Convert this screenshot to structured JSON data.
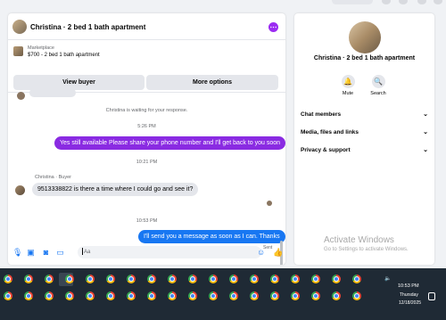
{
  "chat": {
    "header": {
      "title": "Christina · 2 bed 1 bath apartment",
      "more_icon": "more-dots-icon"
    },
    "marketplace": {
      "label": "Marketplace",
      "listing": "$700 - 2 bed 1 bath apartment",
      "view_buyer": "View buyer",
      "more_options": "More options"
    },
    "messages": {
      "waiting": "Christina is waiting for your response.",
      "time1": "5:26 PM",
      "out1": "Yes still available Please share your phone number and I'll get back to you soon",
      "time2": "10:21 PM",
      "sender": "Christina · Buyer",
      "in1": "9513338822 is there a time where I could go and see it?",
      "time3": "10:53 PM",
      "out2": "I'll send you a message as soon as I can. Thanks",
      "status": "Sent"
    },
    "composer": {
      "placeholder": "Aa"
    }
  },
  "info": {
    "title": "Christina · 2 bed 1 bath apartment",
    "mute": "Mute",
    "search": "Search",
    "sections": [
      "Chat members",
      "Media, files and links",
      "Privacy & support"
    ]
  },
  "watermark": {
    "line1": "Activate Windows",
    "line2": "Go to Settings to activate Windows."
  },
  "taskbar": {
    "time": "10:53 PM",
    "day": "Thursday",
    "date": "12/18/2025"
  },
  "colors": {
    "accent_purple": "#8a2be2",
    "accent_blue": "#1877f2",
    "taskbar": "#1f2a35"
  }
}
